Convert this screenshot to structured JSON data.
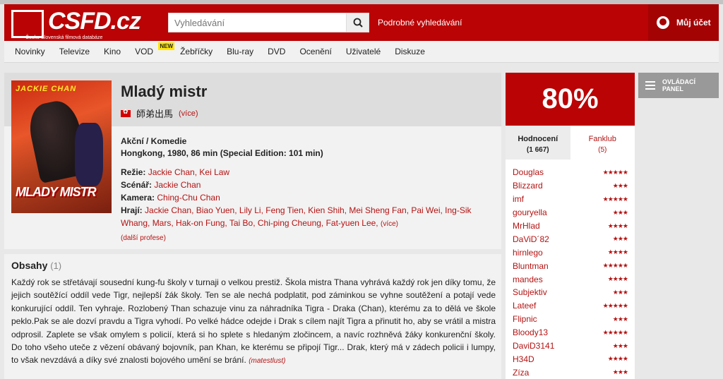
{
  "header": {
    "logo_text": "CSFD.cz",
    "logo_tagline": "Česko-Slovenská filmová databáze",
    "search_placeholder": "Vyhledávání",
    "advanced_search": "Podrobné vyhledávání",
    "account": "Můj účet"
  },
  "nav": {
    "items": [
      "Novinky",
      "Televize",
      "Kino",
      "VOD",
      "Žebříčky",
      "Blu-ray",
      "DVD",
      "Ocenění",
      "Uživatelé",
      "Diskuze"
    ],
    "vod_badge": "NEW"
  },
  "movie": {
    "title": "Mladý mistr",
    "original_title": "師弟出馬",
    "more": "(více)",
    "poster_top_text": "JACKIE CHAN",
    "poster_bottom_text": "MLADY MISTR",
    "genre": "Akční / Komedie",
    "origin": "Hongkong, 1980, 86 min (Special Edition: 101 min)",
    "director_label": "Režie:",
    "directors": "Jackie Chan, Kei Law",
    "writer_label": "Scénář:",
    "writers": "Jackie Chan",
    "camera_label": "Kamera:",
    "camera": "Ching-Chu Chan",
    "cast_label": "Hrají:",
    "cast": "Jackie Chan, Biao Yuen, Lily Li, Feng Tien, Kien Shih, Mei Sheng Fan, Pai Wei, Ing-Sik Whang, Mars, Hak-on Fung, Tai Bo, Chi-ping Cheung, Fat-yuen Lee,",
    "cast_more": "(více)",
    "more_professions": "(další profese)"
  },
  "plot": {
    "heading": "Obsahy",
    "count": "(1)",
    "text": "Každý rok se střetávají sousední kung-fu školy v turnaji o velkou prestiž. Škola mistra Thana vyhrává každý rok jen díky tomu, že jejich soutěžící oddíl vede Tigr, nejlepší žák školy. Ten se ale nechá podplatit, pod záminkou se vyhne soutěžení a potají vede konkurující oddíl. Ten vyhraje. Rozlobený Than schazuje vinu za náhradníka Tigra - Draka (Chan), kterému za to dělá ve škole peklo.Pak se ale dozví pravdu a Tigra vyhodí. Po velké hádce odejde i Drak s cílem najít Tigra a přinutit ho, aby se vrátil a mistra odprosil. Zaplete se však omylem s policií, která si ho splete s hledaným zločincem, a navíc rozhněvá žáky konkurenční školy. Do toho všeho uteče z vězení obávaný bojovník, pan Khan, ke kterému se připojí Tigr... Drak, který má v zádech policii i lumpy, to však nevzdává a díky své znalosti bojového umění se brání.",
    "author": "(matestlust)"
  },
  "rating": {
    "score": "80%",
    "tab_ratings": "Hodnocení",
    "tab_ratings_count": "(1 667)",
    "tab_fanclub": "Fanklub",
    "tab_fanclub_count": "(5)",
    "users": [
      {
        "name": "Douglas",
        "stars": 5
      },
      {
        "name": "Blizzard",
        "stars": 3
      },
      {
        "name": "imf",
        "stars": 5
      },
      {
        "name": "gouryella",
        "stars": 3
      },
      {
        "name": "MrHlad",
        "stars": 4
      },
      {
        "name": "DaViD´82",
        "stars": 3
      },
      {
        "name": "hirnlego",
        "stars": 4
      },
      {
        "name": "Bluntman",
        "stars": 5
      },
      {
        "name": "mandes",
        "stars": 4
      },
      {
        "name": "Subjektiv",
        "stars": 3
      },
      {
        "name": "Lateef",
        "stars": 5
      },
      {
        "name": "Flipnic",
        "stars": 3
      },
      {
        "name": "Bloody13",
        "stars": 5
      },
      {
        "name": "DaviD3141",
        "stars": 3
      },
      {
        "name": "H34D",
        "stars": 4
      },
      {
        "name": "Zíza",
        "stars": 3
      }
    ]
  },
  "control_panel": {
    "line1": "OVLÁDACÍ",
    "line2": "PANEL"
  },
  "colors": {
    "brand_red": "#ba0305",
    "link_red": "#b41313",
    "badge_yellow": "#ffe500"
  }
}
